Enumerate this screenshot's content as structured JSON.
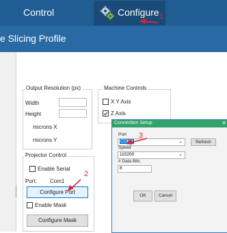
{
  "menu": {
    "control": "Control",
    "configure": "Configure"
  },
  "annotations": {
    "n1": "1",
    "n2": "2",
    "n3": "3"
  },
  "window": {
    "title": "e Slicing Profile"
  },
  "output": {
    "legend": "Output Resolution (px)",
    "width": "Width",
    "height": "Height",
    "microns_x": "microns X",
    "microns_y": "microns Y",
    "width_value": "",
    "height_value": ""
  },
  "machine": {
    "legend": "Machine Controls",
    "xy_axis": "X Y Axis",
    "z_axis": "Z Axis",
    "xy_checked": false,
    "z_checked": true
  },
  "projector": {
    "legend": "Projector Control",
    "enable_serial": "Enable Serial",
    "port_label": "Port:",
    "port_value": "Com1",
    "configure_port": "Configure Port",
    "enable_mask": "Enable Mask",
    "configure_mask": "Configure Mask"
  },
  "dialog": {
    "title": "Connection Setup",
    "close": "✕",
    "port_label": "Port",
    "port_value": "COM4",
    "refresh": "Refresh",
    "speed_label": "Speed",
    "speed_value": "115200",
    "databits_label": "# Data Bits",
    "databits_value": "8",
    "ok": "OK",
    "cancel": "Cancel"
  },
  "colors": {
    "topbar": "#1f5d93",
    "titlebar": "#2a6aa4",
    "dialog_title": "#31a26a",
    "annotation": "#e1232e",
    "selection": "#0078d7"
  }
}
